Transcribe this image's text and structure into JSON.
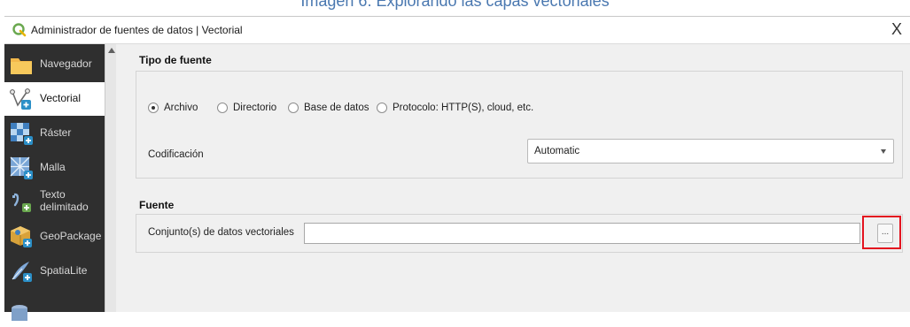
{
  "caption": "Imagen 6. Explorando las capas vectoriales",
  "window": {
    "title": "Administrador de fuentes de datos | Vectorial",
    "close_glyph": "X"
  },
  "sidebar": {
    "items": [
      {
        "label": "Navegador",
        "icon": "folder-icon",
        "active": false
      },
      {
        "label": "Vectorial",
        "icon": "vector-layer-icon",
        "active": true
      },
      {
        "label": "Ráster",
        "icon": "raster-layer-icon",
        "active": false
      },
      {
        "label": "Malla",
        "icon": "mesh-layer-icon",
        "active": false
      },
      {
        "label": "Texto delimitado",
        "line1": "Texto",
        "line2": "delimitado",
        "icon": "delimited-text-icon",
        "active": false
      },
      {
        "label": "GeoPackage",
        "icon": "geopackage-icon",
        "active": false
      },
      {
        "label": "SpatiaLite",
        "icon": "spatialite-icon",
        "active": false
      }
    ]
  },
  "source_type": {
    "heading": "Tipo de fuente",
    "options": [
      {
        "label": "Archivo",
        "selected": true
      },
      {
        "label": "Directorio",
        "selected": false
      },
      {
        "label": "Base de datos",
        "selected": false
      },
      {
        "label": "Protocolo: HTTP(S), cloud, etc.",
        "selected": false
      }
    ],
    "encoding_label": "Codificación",
    "encoding_value": "Automatic"
  },
  "source": {
    "heading": "Fuente",
    "dataset_label": "Conjunto(s) de datos vectoriales",
    "dataset_value": "",
    "browse_label": "..."
  },
  "colors": {
    "highlight": "#e3141f",
    "sidebar_bg": "#2f2f2f",
    "caption": "#4a78b0"
  }
}
